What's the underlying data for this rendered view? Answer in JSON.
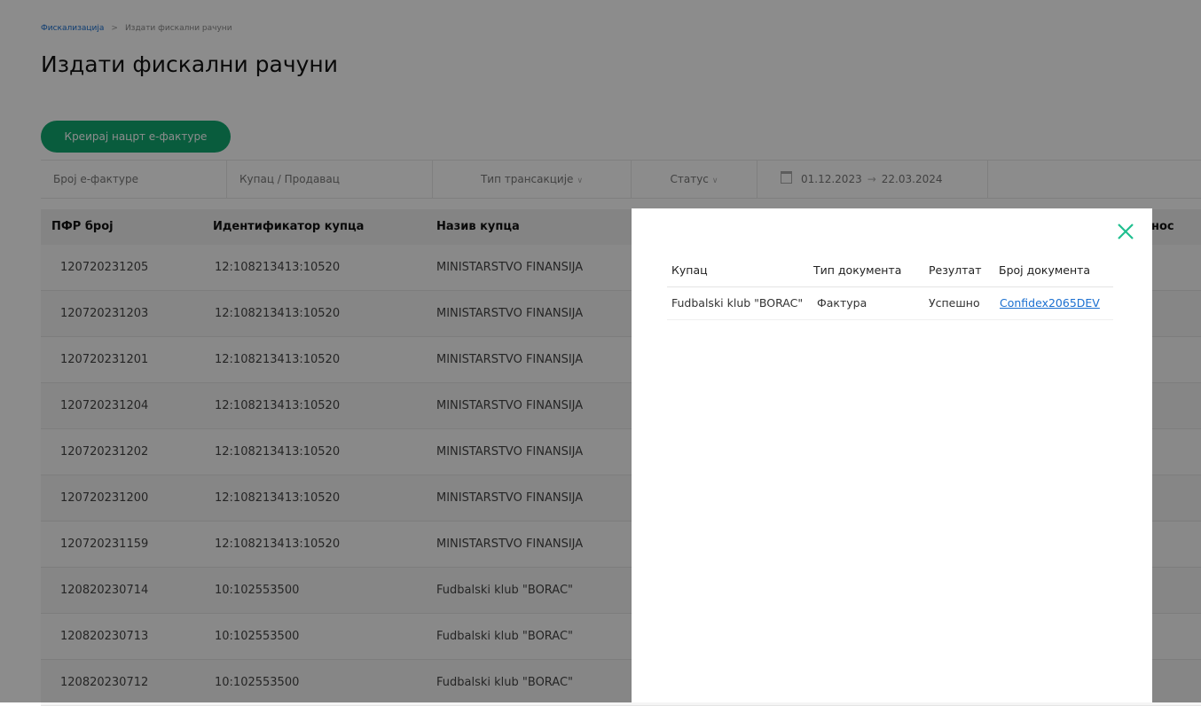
{
  "breadcrumb": {
    "root": "Фискализација",
    "current": "Издати фискални рачуни"
  },
  "page_title": "Издати фискални рачуни",
  "create_button": "Креирај нацрт е-фактуре",
  "filters": {
    "invoice_number": "Број е-фактуре",
    "buyer_seller": "Купац / Продавац",
    "transaction_type": "Тип трансакције",
    "status": "Статус",
    "date_from": "01.12.2023",
    "date_to": "22.03.2024"
  },
  "table": {
    "headers": [
      "ПФР број",
      "Идентификатор купца",
      "Назив купца",
      "нос"
    ],
    "rows": [
      [
        "120720231205",
        "12:108213413:10520",
        "MINISTARSTVO FINANSIJA"
      ],
      [
        "120720231203",
        "12:108213413:10520",
        "MINISTARSTVO FINANSIJA"
      ],
      [
        "120720231201",
        "12:108213413:10520",
        "MINISTARSTVO FINANSIJA"
      ],
      [
        "120720231204",
        "12:108213413:10520",
        "MINISTARSTVO FINANSIJA"
      ],
      [
        "120720231202",
        "12:108213413:10520",
        "MINISTARSTVO FINANSIJA"
      ],
      [
        "120720231200",
        "12:108213413:10520",
        "MINISTARSTVO FINANSIJA"
      ],
      [
        "120720231159",
        "12:108213413:10520",
        "MINISTARSTVO FINANSIJA"
      ],
      [
        "120820230714",
        "10:102553500",
        "Fudbalski klub \"BORAC\""
      ],
      [
        "120820230713",
        "10:102553500",
        "Fudbalski klub \"BORAC\""
      ],
      [
        "120820230712",
        "10:102553500",
        "Fudbalski klub \"BORAC\""
      ]
    ]
  },
  "modal": {
    "headers": [
      "Купац",
      "Тип документа",
      "Резултат",
      "Број документа"
    ],
    "rows": [
      [
        "Fudbalski klub \"BORAC\"",
        "Фактура",
        "Успешно",
        "Confidex2065DEV"
      ]
    ]
  },
  "colors": {
    "accent": "#12a870",
    "link": "#1a6fd0",
    "close_icon": "#1fbf8f"
  }
}
